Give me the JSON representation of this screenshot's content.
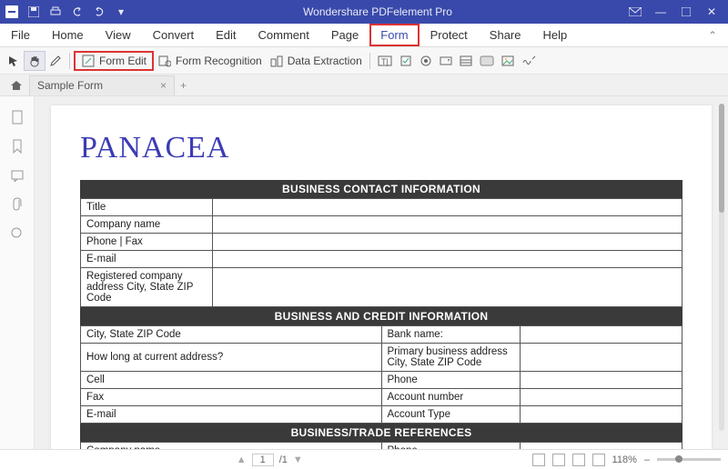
{
  "app": {
    "title": "Wondershare PDFelement Pro"
  },
  "menu": {
    "items": [
      "File",
      "Home",
      "View",
      "Convert",
      "Edit",
      "Comment",
      "Page",
      "Form",
      "Protect",
      "Share",
      "Help"
    ],
    "highlighted": "Form"
  },
  "toolbar": {
    "form_edit": "Form Edit",
    "form_recognition": "Form Recognition",
    "data_extraction": "Data Extraction"
  },
  "tabs": {
    "name": "Sample Form"
  },
  "document": {
    "heading": "PANACEA",
    "section1": {
      "title": "BUSINESS CONTACT INFORMATION",
      "rows": [
        "Title",
        "Company name",
        "Phone | Fax",
        "E-mail",
        "Registered company address City, State ZIP Code"
      ]
    },
    "section2": {
      "title": "BUSINESS AND CREDIT INFORMATION",
      "rows": [
        {
          "l": "City, State ZIP Code",
          "r": "Bank name:"
        },
        {
          "l": "How long at current address?",
          "r": "Primary business address City, State ZIP Code"
        },
        {
          "l": "Cell",
          "r": "Phone"
        },
        {
          "l": "Fax",
          "r": "Account number"
        },
        {
          "l": "E-mail",
          "r": "Account Type"
        }
      ]
    },
    "section3": {
      "title": "BUSINESS/TRADE REFERENCES",
      "rows": [
        {
          "l": "Company name",
          "r": "Phone"
        }
      ]
    }
  },
  "status": {
    "page_current": "1",
    "page_sep": "/1",
    "zoom": "118%",
    "zoom_minus": "–"
  }
}
